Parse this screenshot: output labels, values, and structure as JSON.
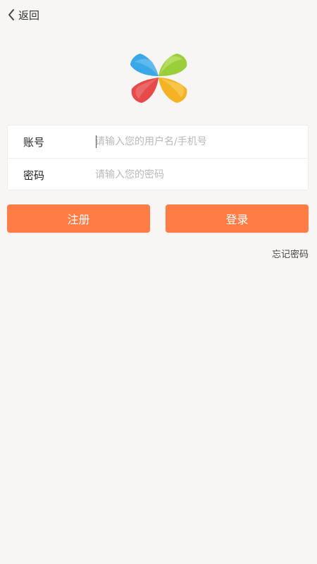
{
  "header": {
    "back_label": "返回",
    "back_icon": "chevron-left-icon"
  },
  "logo": {
    "icon": "pinwheel-logo",
    "colors": [
      "#3aa7e6",
      "#9bcf3a",
      "#e74a4a",
      "#f4b324"
    ]
  },
  "form": {
    "account": {
      "label": "账号",
      "placeholder": "请输入您的用户名/手机号",
      "value": ""
    },
    "password": {
      "label": "密码",
      "placeholder": "请输入您的密码",
      "value": ""
    }
  },
  "actions": {
    "register_label": "注册",
    "login_label": "登录",
    "forgot_label": "忘记密码"
  },
  "theme": {
    "accent": "#ff7c45",
    "background": "#f7f6f4"
  }
}
